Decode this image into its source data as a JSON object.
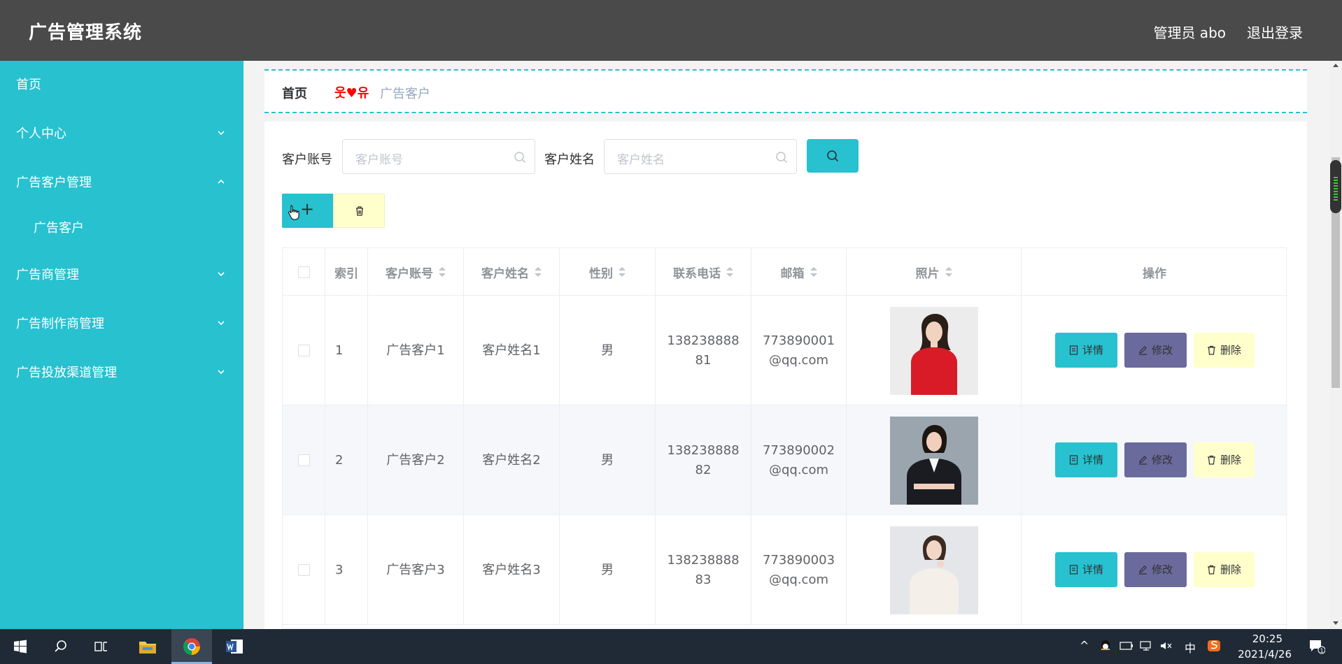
{
  "header": {
    "app_title": "广告管理系统",
    "user": "管理员 abo",
    "logout": "退出登录"
  },
  "sidebar": {
    "items": [
      {
        "label": "首页"
      },
      {
        "label": "个人中心"
      },
      {
        "label": "广告客户管理"
      },
      {
        "label": "广告客户"
      },
      {
        "label": "广告商管理"
      },
      {
        "label": "广告制作商管理"
      },
      {
        "label": "广告投放渠道管理"
      }
    ]
  },
  "breadcrumb": {
    "home": "首页",
    "separator": "웃♥유",
    "current": "广告客户"
  },
  "search": {
    "account_label": "客户账号",
    "account_placeholder": "客户账号",
    "name_label": "客户姓名",
    "name_placeholder": "客户姓名"
  },
  "toolbar": {
    "add_label": "+"
  },
  "table": {
    "headers": {
      "index": "索引",
      "account": "客户账号",
      "name": "客户姓名",
      "gender": "性别",
      "phone": "联系电话",
      "email": "邮箱",
      "photo": "照片",
      "actions": "操作"
    },
    "rows": [
      {
        "index": "1",
        "account": "广告客户1",
        "name": "客户姓名1",
        "gender": "男",
        "phone": "13823888881",
        "email": "773890001@qq.com"
      },
      {
        "index": "2",
        "account": "广告客户2",
        "name": "客户姓名2",
        "gender": "男",
        "phone": "13823888882",
        "email": "773890002@qq.com"
      },
      {
        "index": "3",
        "account": "广告客户3",
        "name": "客户姓名3",
        "gender": "男",
        "phone": "13823888883",
        "email": "773890003@qq.com"
      }
    ],
    "action_labels": {
      "detail": "详情",
      "edit": "修改",
      "delete": "删除"
    }
  },
  "colors": {
    "header_bg": "#4a4a4a",
    "sidebar_bg": "#27c1d0",
    "accent": "#27c1d0",
    "edit_btn": "#6a6a9c",
    "delete_btn": "#ffffcc"
  },
  "taskbar": {
    "ime": "中",
    "time": "20:25",
    "date": "2021/4/26"
  }
}
